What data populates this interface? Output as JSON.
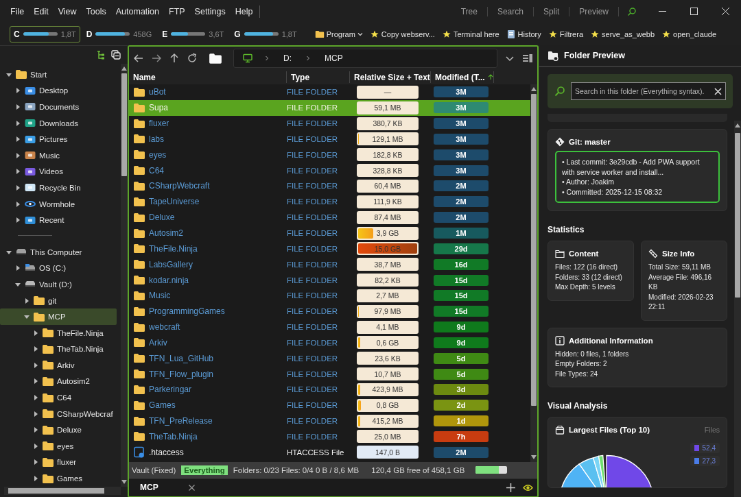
{
  "menu": [
    "File",
    "Edit",
    "View",
    "Tools",
    "Automation",
    "FTP",
    "Settings",
    "Help"
  ],
  "view_buttons": [
    "Tree",
    "Search",
    "Split",
    "Preview"
  ],
  "drives": [
    {
      "letter": "C",
      "level": 0.75,
      "size": "1,8T",
      "selected": true
    },
    {
      "letter": "D",
      "level": 0.85,
      "size": "458G",
      "selected": false
    },
    {
      "letter": "E",
      "level": 0.5,
      "size": "3,6T",
      "selected": false
    },
    {
      "letter": "G",
      "level": 0.85,
      "size": "1,8T",
      "selected": false
    }
  ],
  "bookmarks": [
    {
      "label": "Program",
      "kind": "folder",
      "dropdown": true
    },
    {
      "label": "Copy webserv...",
      "kind": "star",
      "dropdown": false
    },
    {
      "label": "Terminal here",
      "kind": "star",
      "dropdown": false
    },
    {
      "label": "History",
      "kind": "history",
      "dropdown": false
    },
    {
      "label": "Filtrera",
      "kind": "star",
      "dropdown": false
    },
    {
      "label": "serve_as_webb",
      "kind": "star",
      "dropdown": false
    },
    {
      "label": "open_claude",
      "kind": "star",
      "dropdown": false
    }
  ],
  "tree": [
    {
      "label": "Start",
      "kind": "folder",
      "expanded": true,
      "selected": false,
      "children": [
        {
          "label": "Desktop",
          "kind": "desktop",
          "expanded": false,
          "selected": false
        },
        {
          "label": "Documents",
          "kind": "documents",
          "expanded": false,
          "selected": false
        },
        {
          "label": "Downloads",
          "kind": "downloads",
          "expanded": false,
          "selected": false
        },
        {
          "label": "Pictures",
          "kind": "pictures",
          "expanded": false,
          "selected": false
        },
        {
          "label": "Music",
          "kind": "music",
          "expanded": false,
          "selected": false
        },
        {
          "label": "Videos",
          "kind": "videos",
          "expanded": false,
          "selected": false
        },
        {
          "label": "Recycle Bin",
          "kind": "recycle",
          "expanded": false,
          "selected": false
        },
        {
          "label": "Wormhole",
          "kind": "wormhole",
          "expanded": false,
          "selected": false
        },
        {
          "label": "Recent",
          "kind": "recent",
          "expanded": false,
          "selected": false
        }
      ]
    },
    {
      "label": "This Computer",
      "kind": "computer",
      "expanded": true,
      "selected": false,
      "children": [
        {
          "label": "OS (C:)",
          "kind": "os",
          "expanded": false,
          "selected": false
        },
        {
          "label": "Vault (D:)",
          "kind": "drive",
          "expanded": true,
          "selected": false,
          "children": [
            {
              "label": "git",
              "kind": "folder",
              "expanded": false,
              "selected": false
            },
            {
              "label": "MCP",
              "kind": "folder",
              "expanded": true,
              "selected": true,
              "children": [
                {
                  "label": "TheFile.Ninja",
                  "kind": "folder",
                  "expanded": false,
                  "selected": false
                },
                {
                  "label": "TheTab.Ninja",
                  "kind": "folder",
                  "expanded": false,
                  "selected": false
                },
                {
                  "label": "Arkiv",
                  "kind": "folder",
                  "expanded": false,
                  "selected": false
                },
                {
                  "label": "Autosim2",
                  "kind": "folder",
                  "expanded": false,
                  "selected": false
                },
                {
                  "label": "C64",
                  "kind": "folder",
                  "expanded": false,
                  "selected": false
                },
                {
                  "label": "CSharpWebcraf",
                  "kind": "folder",
                  "expanded": false,
                  "selected": false
                },
                {
                  "label": "Deluxe",
                  "kind": "folder",
                  "expanded": false,
                  "selected": false
                },
                {
                  "label": "eyes",
                  "kind": "folder",
                  "expanded": false,
                  "selected": false
                },
                {
                  "label": "fluxer",
                  "kind": "folder",
                  "expanded": false,
                  "selected": false
                },
                {
                  "label": "Games",
                  "kind": "folder",
                  "expanded": false,
                  "selected": false
                }
              ]
            }
          ]
        }
      ]
    }
  ],
  "address": [
    "D:",
    "MCP"
  ],
  "columns": [
    {
      "label": "Name",
      "sorted": false
    },
    {
      "label": "Type",
      "sorted": false
    },
    {
      "label": "Relative Size + Text",
      "sorted": false
    },
    {
      "label": "Modified (T...",
      "sorted": true
    }
  ],
  "rows": [
    {
      "name": "uBot",
      "kind": "folder",
      "type": "FILE FOLDER",
      "size": "—",
      "modified": "3M",
      "color": "#1d4b6b",
      "selected": false
    },
    {
      "name": "Supa",
      "kind": "folder",
      "type": "FILE FOLDER",
      "size": "59,1 MB",
      "modified": "3M",
      "color": "#2e8a72",
      "selected": true
    },
    {
      "name": "fluxer",
      "kind": "folder",
      "type": "FILE FOLDER",
      "size": "380,7 KB",
      "modified": "3M",
      "color": "#1d4b6b",
      "selected": false
    },
    {
      "name": "labs",
      "kind": "folder",
      "type": "FILE FOLDER",
      "size": "129,1 MB",
      "level": 0.01,
      "modified": "3M",
      "color": "#1d4b6b",
      "selected": false
    },
    {
      "name": "eyes",
      "kind": "folder",
      "type": "FILE FOLDER",
      "size": "182,8 KB",
      "modified": "3M",
      "color": "#1d4b6b",
      "selected": false
    },
    {
      "name": "C64",
      "kind": "folder",
      "type": "FILE FOLDER",
      "size": "328,8 KB",
      "modified": "3M",
      "color": "#1d4b6b",
      "selected": false
    },
    {
      "name": "CSharpWebcraft",
      "kind": "folder",
      "type": "FILE FOLDER",
      "size": "60,4 MB",
      "modified": "2M",
      "color": "#1d4b6b",
      "selected": false
    },
    {
      "name": "TapeUniverse",
      "kind": "folder",
      "type": "FILE FOLDER",
      "size": "111,9 KB",
      "modified": "2M",
      "color": "#1d4b6b",
      "selected": false
    },
    {
      "name": "Deluxe",
      "kind": "folder",
      "type": "FILE FOLDER",
      "size": "87,4 MB",
      "modified": "2M",
      "color": "#1d4b6b",
      "selected": false
    },
    {
      "name": "Autosim2",
      "kind": "folder",
      "type": "FILE FOLDER",
      "size": "3,9 GB",
      "level": 0.26,
      "modified": "1M",
      "color": "#175a5e",
      "selected": false
    },
    {
      "name": "TheFile.Ninja",
      "kind": "folder",
      "type": "FILE FOLDER",
      "size": "15,0 GB",
      "level": 1,
      "modified": "29d",
      "color": "#16784a",
      "selected": false
    },
    {
      "name": "LabsGallery",
      "kind": "folder",
      "type": "FILE FOLDER",
      "size": "38,7 MB",
      "modified": "16d",
      "color": "#117a26",
      "selected": false
    },
    {
      "name": "kodar.ninja",
      "kind": "folder",
      "type": "FILE FOLDER",
      "size": "82,2 KB",
      "modified": "15d",
      "color": "#117a26",
      "selected": false
    },
    {
      "name": "Music",
      "kind": "folder",
      "type": "FILE FOLDER",
      "size": "2,7 MB",
      "modified": "15d",
      "color": "#117a26",
      "selected": false
    },
    {
      "name": "ProgrammingGames",
      "kind": "folder",
      "type": "FILE FOLDER",
      "size": "97,9 MB",
      "level": 0.01,
      "modified": "15d",
      "color": "#117a26",
      "selected": false
    },
    {
      "name": "webcraft",
      "kind": "folder",
      "type": "FILE FOLDER",
      "size": "4,1 MB",
      "modified": "9d",
      "color": "#0f7a1c",
      "selected": false
    },
    {
      "name": "Arkiv",
      "kind": "folder",
      "type": "FILE FOLDER",
      "size": "0,6 GB",
      "level": 0.04,
      "modified": "9d",
      "color": "#0f7a1c",
      "selected": false
    },
    {
      "name": "TFN_Lua_GitHub",
      "kind": "folder",
      "type": "FILE FOLDER",
      "size": "23,6 KB",
      "modified": "5d",
      "color": "#3f8a14",
      "selected": false
    },
    {
      "name": "TFN_Flow_plugin",
      "kind": "folder",
      "type": "FILE FOLDER",
      "size": "10,7 MB",
      "modified": "5d",
      "color": "#3f8a14",
      "selected": false
    },
    {
      "name": "Parkeringar",
      "kind": "folder",
      "type": "FILE FOLDER",
      "size": "423,9 MB",
      "level": 0.03,
      "modified": "3d",
      "color": "#6c8a10",
      "selected": false
    },
    {
      "name": "Games",
      "kind": "folder",
      "type": "FILE FOLDER",
      "size": "0,8 GB",
      "level": 0.05,
      "modified": "2d",
      "color": "#7a9412",
      "selected": false
    },
    {
      "name": "TFN_PreRelease",
      "kind": "folder",
      "type": "FILE FOLDER",
      "size": "415,2 MB",
      "level": 0.03,
      "modified": "1d",
      "color": "#b0960c",
      "selected": false
    },
    {
      "name": "TheTab.Ninja",
      "kind": "folder",
      "type": "FILE FOLDER",
      "size": "25,0 MB",
      "modified": "7h",
      "color": "#c83c10",
      "selected": false
    },
    {
      "name": ".htaccess",
      "kind": "file",
      "type": "HTACCESS File",
      "size": "147,0 B",
      "modified": "2M",
      "color": "#1d4b6b",
      "selected": false
    }
  ],
  "status": {
    "drive": "Vault (Fixed)",
    "index": "Everything",
    "counts": "Folders: 0/23 Files: 0/4 0 B / 8,6 MB",
    "free": "120,4 GB free of 458,1 GB",
    "level": 0.74
  },
  "tabs": [
    {
      "label": "MCP",
      "selected": true
    }
  ],
  "preview": {
    "title": "Folder Preview",
    "search_placeholder": "Search in this folder (Everything syntax).",
    "git": {
      "title": "Git: master",
      "lines": [
        "• Last commit: 3e29cdb - Add PWA support with service worker and install...",
        "• Author: Joakim",
        "• Committed: 2025-12-15 08:32"
      ]
    },
    "statistics_heading": "Statistics",
    "stat_cards": [
      {
        "title": "Content",
        "kind": "folder",
        "lines": [
          "Files: 122 (16 direct)",
          "Folders: 33 (12 direct)",
          "Max Depth: 5 levels"
        ]
      },
      {
        "title": "Size Info",
        "kind": "ruler",
        "lines": [
          "Total Size: 59,11 MB",
          "Average File: 496,16 KB",
          "Modified: 2026-02-23 22:11"
        ]
      }
    ],
    "additional": {
      "title": "Additional Information",
      "lines": [
        "Hidden: 0 files, 1 folders",
        "Empty Folders: 2",
        "File Types: 24"
      ]
    },
    "visual_heading": "Visual Analysis",
    "chart_card": {
      "title": "Largest Files (Top 10)",
      "aside": "Files",
      "legend": [
        {
          "value": "52,4",
          "color": "#7048e8"
        },
        {
          "value": "27,3",
          "color": "#4a7ce8"
        }
      ]
    }
  }
}
